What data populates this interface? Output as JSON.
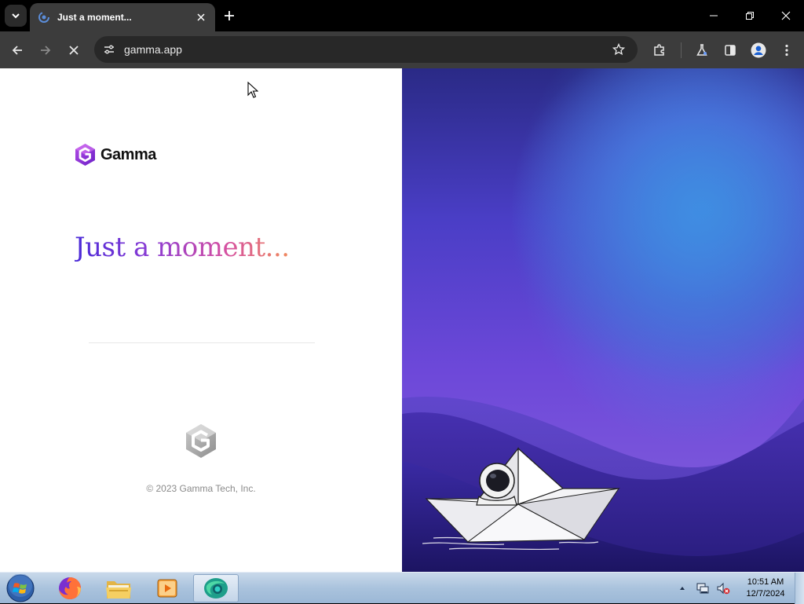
{
  "browser": {
    "tab": {
      "title": "Just a moment..."
    },
    "omnibox": {
      "url": "gamma.app"
    }
  },
  "page": {
    "brand": "Gamma",
    "heading": "Just a moment...",
    "copyright": "© 2023 Gamma Tech, Inc."
  },
  "taskbar": {
    "apps": [
      "firefox-icon",
      "file-explorer-icon",
      "media-player-icon",
      "browser-icon"
    ],
    "clock": {
      "time": "10:51 AM",
      "date": "12/7/2024"
    }
  },
  "colors": {
    "heading_gradient": [
      "#4a2ad8",
      "#8a3bd4",
      "#d44fa2",
      "#f08a5d"
    ],
    "brand_purple": "#8a3bd4",
    "toolbar": "#3c3c3c",
    "titlebar": "#000000"
  }
}
